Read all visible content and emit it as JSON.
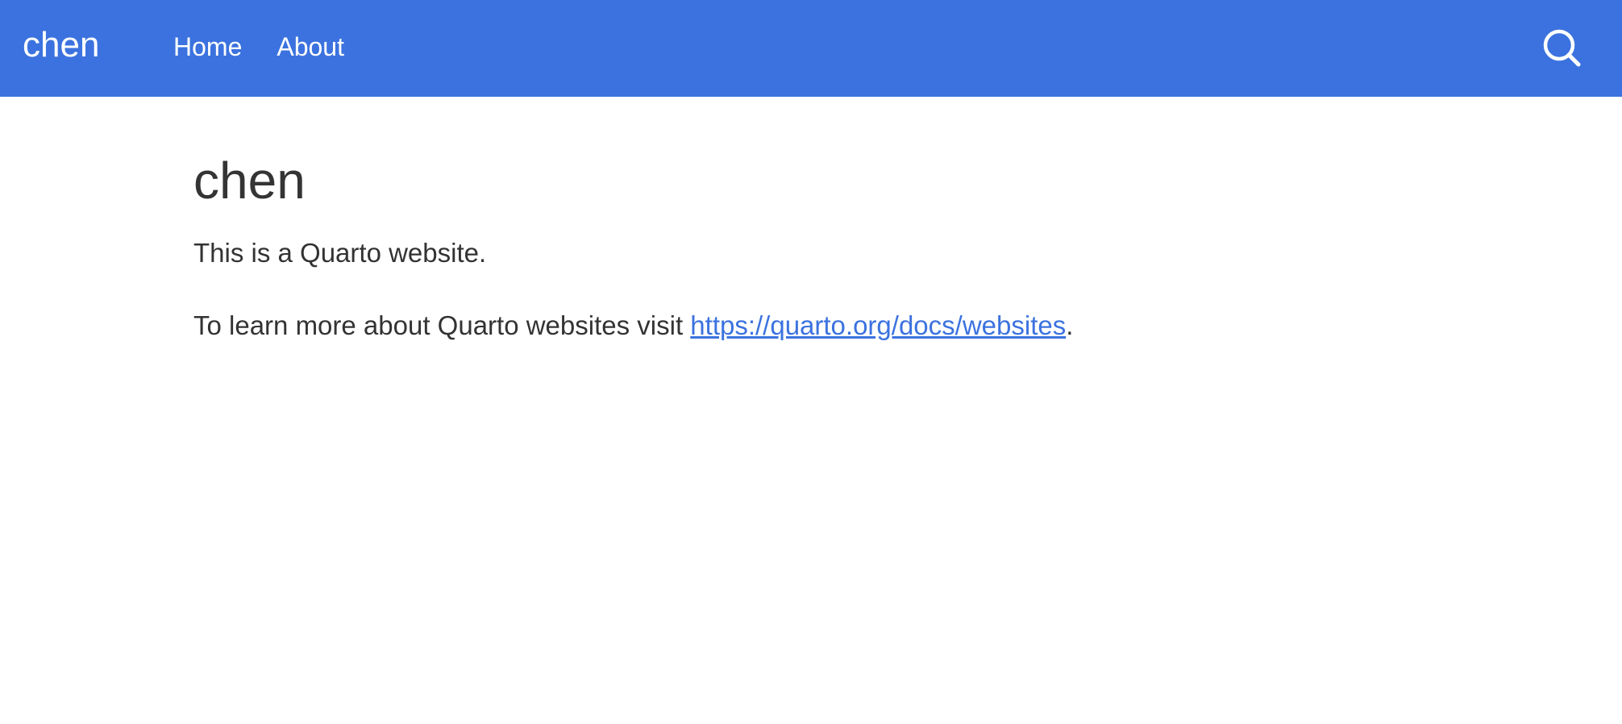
{
  "navbar": {
    "brand": "chen",
    "links": [
      "Home",
      "About"
    ],
    "search_icon": "search-icon",
    "background_color": "#3b72df"
  },
  "main": {
    "title": "chen",
    "paragraph1": "This is a Quarto website.",
    "paragraph2_prefix": "To learn more about Quarto websites visit ",
    "paragraph2_link": "https://quarto.org/docs/websites",
    "paragraph2_suffix": "."
  }
}
